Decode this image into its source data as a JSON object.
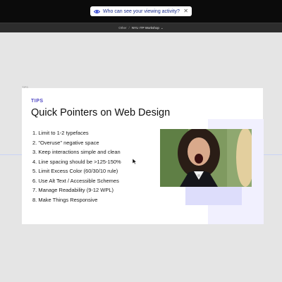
{
  "notification": {
    "text": "Who can see your viewing activity?",
    "close_icon": "close-icon",
    "icon": "eye-icon"
  },
  "breadcrumb": {
    "parent": "Other",
    "separator": "/",
    "current": "NYU ITP Workshop",
    "chevron": "⌄"
  },
  "frame_label": "TIPS",
  "slide": {
    "tag": "TIPS",
    "title": "Quick Pointers on Web Design",
    "items": [
      "1. Limit to 1-2 typefaces",
      "2. \"Overuse\" negative space",
      "3. Keep interactions simple and clean",
      "4. Line spacing should be >125-150%",
      "5. Limit Excess Color (60/30/10 rule)",
      "6. Use Alt Text / Accessible Schemes",
      "7. Manage Readability (9-12 WPL)",
      "8. Make Things Responsive"
    ],
    "accent_color": "#4f46c4"
  },
  "colors": {
    "topbar": "#0b0b0b",
    "canvas": "#e5e5e5",
    "deco_light": "#f1f0fe",
    "deco_mid": "#ddddfb"
  }
}
